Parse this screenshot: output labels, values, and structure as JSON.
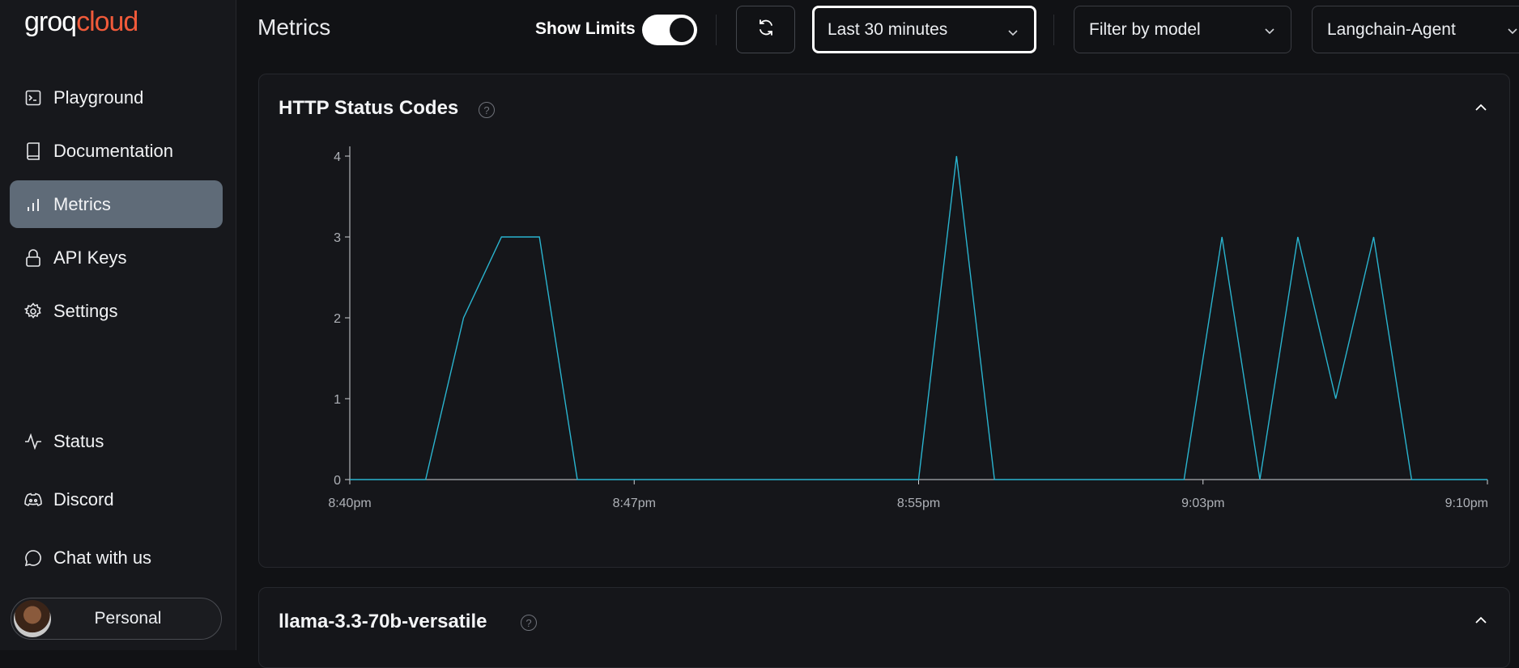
{
  "brand": {
    "logo_part1": "groq",
    "logo_part2": "cloud"
  },
  "sidebar": {
    "items": [
      {
        "label": "Playground",
        "icon": "terminal-icon"
      },
      {
        "label": "Documentation",
        "icon": "book-icon"
      },
      {
        "label": "Metrics",
        "icon": "bar-chart-icon",
        "active": true
      },
      {
        "label": "API Keys",
        "icon": "lock-icon"
      },
      {
        "label": "Settings",
        "icon": "gear-icon"
      }
    ],
    "bottom_items": [
      {
        "label": "Status",
        "icon": "activity-icon"
      },
      {
        "label": "Discord",
        "icon": "discord-icon"
      },
      {
        "label": "Chat with us",
        "icon": "chat-bubble-icon"
      }
    ],
    "account": {
      "label": "Personal"
    }
  },
  "header": {
    "title": "Metrics",
    "show_limits_label": "Show Limits",
    "show_limits_on": true,
    "time_range": "Last 30 minutes",
    "model_filter": "Filter by model",
    "project": "Langchain-Agent"
  },
  "cards": [
    {
      "title": "HTTP Status Codes",
      "expanded": true
    },
    {
      "title": "llama-3.3-70b-versatile",
      "expanded": true
    }
  ],
  "colors": {
    "accent": "#2ab4cf",
    "active_nav": "#5f6b78",
    "logo_cloud": "#f05a3a"
  },
  "chart_data": {
    "type": "line",
    "title": "HTTP Status Codes",
    "x_tick_labels": [
      "8:40pm",
      "8:47pm",
      "8:55pm",
      "9:03pm",
      "9:10pm"
    ],
    "x_range_minutes_after_840pm": [
      0,
      30
    ],
    "y_ticks": [
      "0",
      "1",
      "2",
      "3",
      "4"
    ],
    "ylim": [
      0,
      4
    ],
    "grid": false,
    "series": [
      {
        "x_minutes_after_840pm": [
          0,
          1,
          2,
          3,
          4,
          5,
          6,
          7,
          8,
          9,
          10,
          11,
          12,
          13,
          14,
          15,
          16,
          17,
          18,
          19,
          20,
          21,
          22,
          23,
          24,
          25,
          26,
          27,
          28,
          29,
          30
        ],
        "values": [
          0,
          0,
          0,
          2,
          3,
          3,
          0,
          0,
          0,
          0,
          0,
          0,
          0,
          0,
          0,
          0,
          4,
          0,
          0,
          0,
          0,
          0,
          0,
          3,
          0,
          3,
          1,
          3,
          0,
          0,
          0
        ],
        "color": "#2ab4cf"
      }
    ]
  }
}
